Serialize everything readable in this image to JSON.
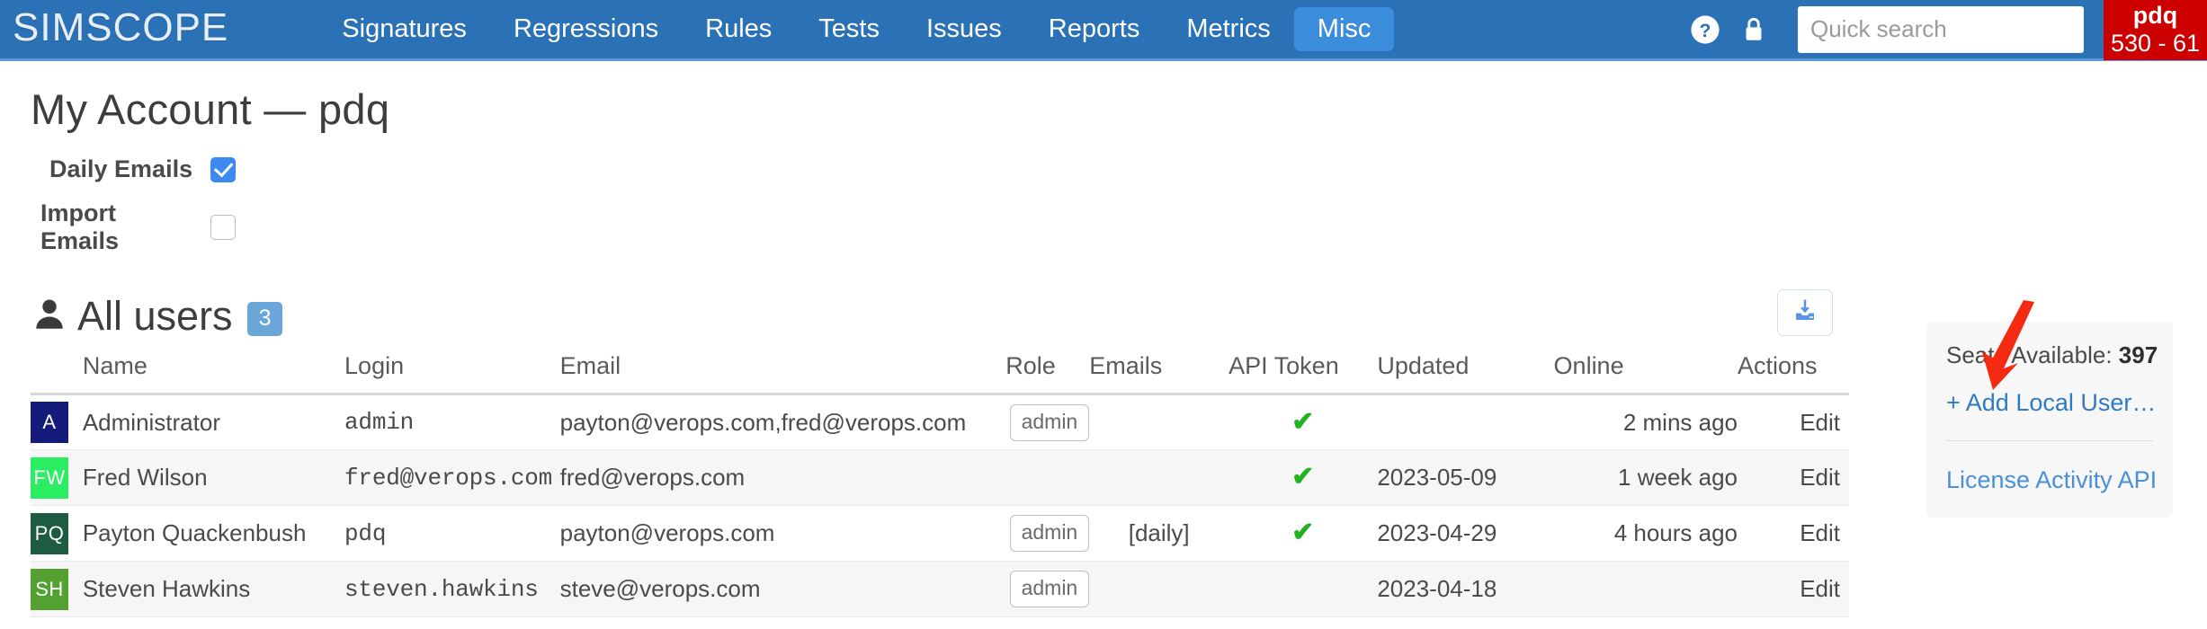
{
  "navbar": {
    "brand": "SIMSCOPE",
    "items": [
      {
        "label": "Signatures",
        "active": false
      },
      {
        "label": "Regressions",
        "active": false
      },
      {
        "label": "Rules",
        "active": false
      },
      {
        "label": "Tests",
        "active": false
      },
      {
        "label": "Issues",
        "active": false
      },
      {
        "label": "Reports",
        "active": false
      },
      {
        "label": "Metrics",
        "active": false
      },
      {
        "label": "Misc",
        "active": true
      }
    ],
    "help_icon": "question-circle-icon",
    "lock_icon": "lock-icon",
    "search": {
      "placeholder": "Quick search",
      "value": "",
      "icon": "search-icon"
    },
    "user": {
      "name": "pdq",
      "sub": "530 - 61",
      "color": "#cc0000"
    },
    "bg_color": "#2a72b5",
    "active_tab_color": "#3d8ddd"
  },
  "page": {
    "title": "My Account — pdq",
    "prefs": [
      {
        "label": "Daily Emails",
        "checked": true
      },
      {
        "label": "Import Emails",
        "checked": false
      }
    ]
  },
  "users_section": {
    "icon": "person-icon",
    "title": "All users",
    "count": "3",
    "export_icon": "download-inbox-icon",
    "columns": [
      "Name",
      "Login",
      "Email",
      "Role",
      "Emails",
      "API Token",
      "Updated",
      "Online",
      "Actions"
    ],
    "rows": [
      {
        "initials": "A",
        "avatar_color": "#151b7a",
        "name": "Administrator",
        "login": "admin",
        "email": "payton@verops.com,fred@verops.com",
        "role": "admin",
        "emails": "",
        "api_token": true,
        "updated": "",
        "online": "2 mins ago",
        "action": "Edit"
      },
      {
        "initials": "FW",
        "avatar_color": "#2bed62",
        "name": "Fred Wilson",
        "login": "fred@verops.com",
        "email": "fred@verops.com",
        "role": "",
        "emails": "",
        "api_token": true,
        "updated": "2023-05-09",
        "online": "1 week ago",
        "action": "Edit"
      },
      {
        "initials": "PQ",
        "avatar_color": "#1d5c40",
        "name": "Payton Quackenbush",
        "login": "pdq",
        "email": "payton@verops.com",
        "role": "admin",
        "emails": "[daily]",
        "api_token": true,
        "updated": "2023-04-29",
        "online": "4 hours ago",
        "action": "Edit"
      },
      {
        "initials": "SH",
        "avatar_color": "#52a131",
        "name": "Steven Hawkins",
        "login": "steven.hawkins",
        "email": "steve@verops.com",
        "role": "admin",
        "emails": "",
        "api_token": false,
        "updated": "2023-04-18",
        "online": "",
        "action": "Edit"
      }
    ]
  },
  "side_card": {
    "seats_label": "Seats Available:",
    "seats_value": "397",
    "add_user_label": "+ Add Local User…",
    "license_label": "License Activity API"
  },
  "annotation": {
    "arrow_color": "#f42b12"
  }
}
